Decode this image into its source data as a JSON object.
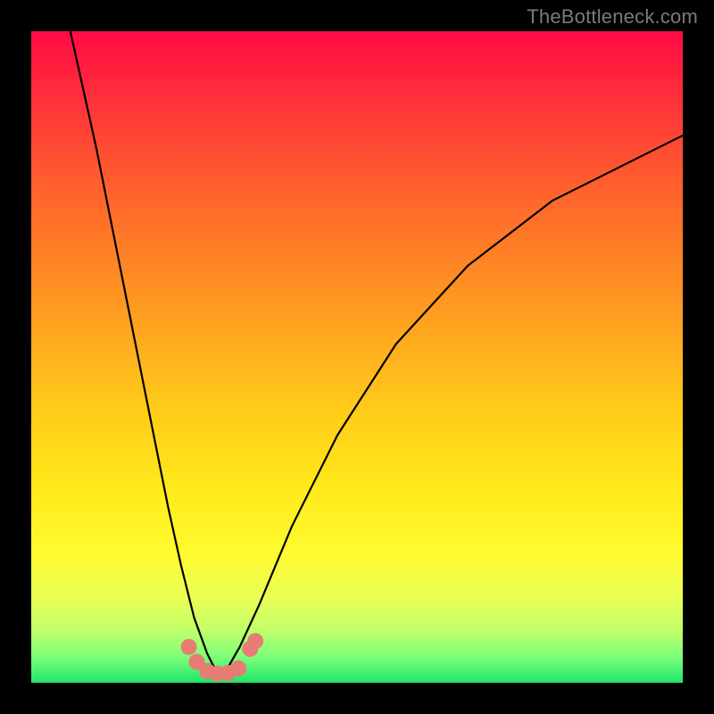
{
  "watermark": "TheBottleneck.com",
  "chart_data": {
    "type": "line",
    "title": "",
    "xlabel": "",
    "ylabel": "",
    "xlim": [
      0,
      100
    ],
    "ylim": [
      0,
      100
    ],
    "note": "Two V-shaped curves on a vertical red-to-green gradient; both dip to ~0 near x≈28. No axis ticks or numeric labels are rendered; values are estimated from pixel positions on a 0–100 normalized scale.",
    "series": [
      {
        "name": "left-branch",
        "x": [
          6,
          10,
          14,
          18,
          21,
          23,
          25,
          27,
          28.5
        ],
        "y": [
          100,
          82,
          62,
          42,
          27,
          18,
          10,
          4.5,
          1.5
        ]
      },
      {
        "name": "right-branch",
        "x": [
          30,
          32,
          35,
          40,
          47,
          56,
          67,
          80,
          94,
          100
        ],
        "y": [
          2,
          5.5,
          12,
          24,
          38,
          52,
          64,
          74,
          81,
          84
        ]
      }
    ],
    "markers": {
      "name": "bottom-cluster",
      "points": [
        {
          "x": 24.2,
          "y": 5.5
        },
        {
          "x": 25.4,
          "y": 3.2
        },
        {
          "x": 27.0,
          "y": 1.8
        },
        {
          "x": 28.6,
          "y": 1.4
        },
        {
          "x": 30.2,
          "y": 1.5
        },
        {
          "x": 31.8,
          "y": 2.2
        },
        {
          "x": 33.6,
          "y": 5.2
        },
        {
          "x": 34.4,
          "y": 6.4
        }
      ],
      "radius_px": 9,
      "color": "#e77c74"
    },
    "background_gradient": {
      "top": "#ff0b44",
      "bottom": "#1fe56a"
    }
  }
}
